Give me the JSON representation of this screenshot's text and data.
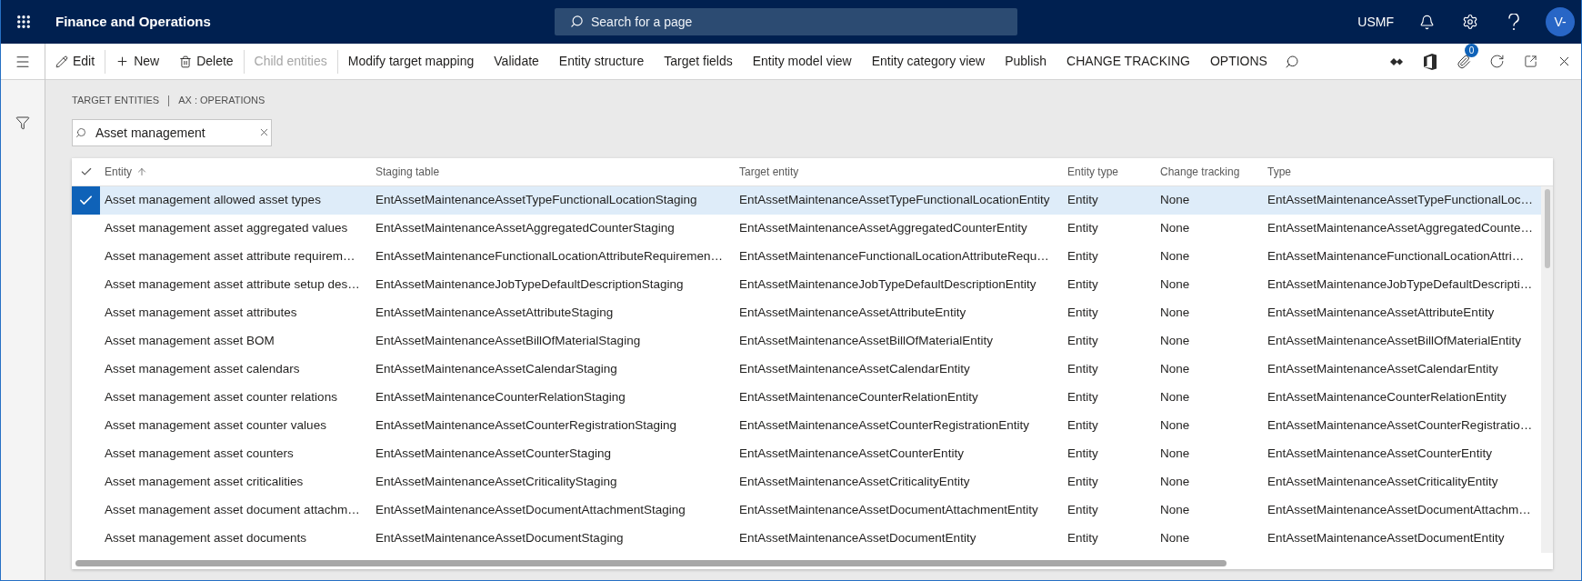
{
  "app_bar": {
    "title": "Finance and Operations",
    "search": {
      "placeholder": "Search for a page"
    },
    "company": "USMF",
    "avatar": "V-"
  },
  "action_pane": {
    "groups": [
      [
        {
          "label": "Edit",
          "kind": "edit",
          "disabled": false
        }
      ],
      [
        {
          "label": "New",
          "kind": "new",
          "disabled": false
        },
        {
          "label": "Delete",
          "kind": "delete",
          "disabled": false
        }
      ],
      [
        {
          "label": "Child entities",
          "kind": "action",
          "disabled": true
        }
      ],
      [
        {
          "label": "Modify target mapping",
          "kind": "action",
          "disabled": false
        },
        {
          "label": "Validate",
          "kind": "action",
          "disabled": false
        },
        {
          "label": "Entity structure",
          "kind": "action",
          "disabled": false
        },
        {
          "label": "Target fields",
          "kind": "action",
          "disabled": false
        },
        {
          "label": "Entity model view",
          "kind": "action",
          "disabled": false
        },
        {
          "label": "Entity category view",
          "kind": "action",
          "disabled": false
        },
        {
          "label": "Publish",
          "kind": "action",
          "disabled": false
        },
        {
          "label": "CHANGE TRACKING",
          "kind": "action",
          "disabled": false
        },
        {
          "label": "OPTIONS",
          "kind": "action",
          "disabled": false
        }
      ]
    ],
    "attachment_count": "0"
  },
  "breadcrumb": [
    "TARGET ENTITIES",
    "AX : OPERATIONS"
  ],
  "filter": {
    "value": "Asset management"
  },
  "grid": {
    "columns": [
      {
        "label": "Entity",
        "sorted": true
      },
      {
        "label": "Staging table",
        "sorted": false
      },
      {
        "label": "Target entity",
        "sorted": false
      },
      {
        "label": "Entity type",
        "sorted": false
      },
      {
        "label": "Change tracking",
        "sorted": false
      },
      {
        "label": "Type",
        "sorted": false
      }
    ],
    "rows": [
      {
        "selected": true,
        "cells": [
          "Asset management allowed asset types",
          "EntAssetMaintenanceAssetTypeFunctionalLocationStaging",
          "EntAssetMaintenanceAssetTypeFunctionalLocationEntity",
          "Entity",
          "None",
          "EntAssetMaintenanceAssetTypeFunctionalLoc…"
        ]
      },
      {
        "selected": false,
        "cells": [
          "Asset management asset aggregated values",
          "EntAssetMaintenanceAssetAggregatedCounterStaging",
          "EntAssetMaintenanceAssetAggregatedCounterEntity",
          "Entity",
          "None",
          "EntAssetMaintenanceAssetAggregatedCounte…"
        ]
      },
      {
        "selected": false,
        "cells": [
          "Asset management asset attribute requirem…",
          "EntAssetMaintenanceFunctionalLocationAttributeRequiremen…",
          "EntAssetMaintenanceFunctionalLocationAttributeRequ…",
          "Entity",
          "None",
          "EntAssetMaintenanceFunctionalLocationAttri…"
        ]
      },
      {
        "selected": false,
        "cells": [
          "Asset management asset attribute setup des…",
          "EntAssetMaintenanceJobTypeDefaultDescriptionStaging",
          "EntAssetMaintenanceJobTypeDefaultDescriptionEntity",
          "Entity",
          "None",
          "EntAssetMaintenanceJobTypeDefaultDescripti…"
        ]
      },
      {
        "selected": false,
        "cells": [
          "Asset management asset attributes",
          "EntAssetMaintenanceAssetAttributeStaging",
          "EntAssetMaintenanceAssetAttributeEntity",
          "Entity",
          "None",
          "EntAssetMaintenanceAssetAttributeEntity"
        ]
      },
      {
        "selected": false,
        "cells": [
          "Asset management asset BOM",
          "EntAssetMaintenanceAssetBillOfMaterialStaging",
          "EntAssetMaintenanceAssetBillOfMaterialEntity",
          "Entity",
          "None",
          "EntAssetMaintenanceAssetBillOfMaterialEntity"
        ]
      },
      {
        "selected": false,
        "cells": [
          "Asset management asset calendars",
          "EntAssetMaintenanceAssetCalendarStaging",
          "EntAssetMaintenanceAssetCalendarEntity",
          "Entity",
          "None",
          "EntAssetMaintenanceAssetCalendarEntity"
        ]
      },
      {
        "selected": false,
        "cells": [
          "Asset management asset counter relations",
          "EntAssetMaintenanceCounterRelationStaging",
          "EntAssetMaintenanceCounterRelationEntity",
          "Entity",
          "None",
          "EntAssetMaintenanceCounterRelationEntity"
        ]
      },
      {
        "selected": false,
        "cells": [
          "Asset management asset counter values",
          "EntAssetMaintenanceAssetCounterRegistrationStaging",
          "EntAssetMaintenanceAssetCounterRegistrationEntity",
          "Entity",
          "None",
          "EntAssetMaintenanceAssetCounterRegistratio…"
        ]
      },
      {
        "selected": false,
        "cells": [
          "Asset management asset counters",
          "EntAssetMaintenanceAssetCounterStaging",
          "EntAssetMaintenanceAssetCounterEntity",
          "Entity",
          "None",
          "EntAssetMaintenanceAssetCounterEntity"
        ]
      },
      {
        "selected": false,
        "cells": [
          "Asset management asset criticalities",
          "EntAssetMaintenanceAssetCriticalityStaging",
          "EntAssetMaintenanceAssetCriticalityEntity",
          "Entity",
          "None",
          "EntAssetMaintenanceAssetCriticalityEntity"
        ]
      },
      {
        "selected": false,
        "cells": [
          "Asset management asset document attachm…",
          "EntAssetMaintenanceAssetDocumentAttachmentStaging",
          "EntAssetMaintenanceAssetDocumentAttachmentEntity",
          "Entity",
          "None",
          "EntAssetMaintenanceAssetDocumentAttachm…"
        ]
      },
      {
        "selected": false,
        "cells": [
          "Asset management asset documents",
          "EntAssetMaintenanceAssetDocumentStaging",
          "EntAssetMaintenanceAssetDocumentEntity",
          "Entity",
          "None",
          "EntAssetMaintenanceAssetDocumentEntity"
        ]
      }
    ]
  }
}
